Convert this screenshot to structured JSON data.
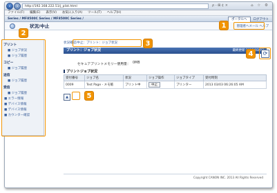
{
  "browser": {
    "url": "http://192.168.222.51/j_plist.html",
    "url_icons": "ρ - ⊠ ¢ ×",
    "win_buttons": "⌂ ☆ ⚙"
  },
  "menu": [
    "ファイル(F)",
    "編集(E)",
    "表示(V)",
    "お気に入り(A)",
    "ツール(T)",
    "ヘルプ(H)"
  ],
  "titlebar": {
    "path": "Series / MF8500C Series / MF8500C Series /",
    "portal_label": "ポータルへ",
    "logout_label": "ログアウト"
  },
  "subheader": {
    "title": "状況/中止",
    "links": "管理者へメール  ヘルプ"
  },
  "sidebar": {
    "sections": [
      {
        "label": "プリント",
        "items": [
          "■ ジョブ状況",
          "■ ジョブ履歴"
        ]
      },
      {
        "label": "コピー",
        "items": [
          "■ ジョブ履歴"
        ]
      },
      {
        "label": "送信",
        "items": [
          "■ ジョブ履歴"
        ]
      },
      {
        "label": "受信",
        "items": [
          "■ ジョブ履歴"
        ]
      }
    ],
    "extra_items": [
      "■ エラー情報",
      "■ デバイス情報",
      "■ デバイス情報",
      "■ カウンター確認"
    ]
  },
  "main": {
    "breadcrumb": "状況確認/中止：プリント：ジョブ状況",
    "box_title": "プリント：ジョブ状況",
    "timestamp": "最終更新 2013/03/03",
    "memory_label": "セキュアプリントメモリー使用量：",
    "memory_value": "0MB",
    "list_title": "プリントジョブ状況",
    "columns": [
      "受付番号",
      "ジョブ名",
      "状況",
      "ジョブ操作",
      "ジョブタイプ",
      "受付時刻"
    ],
    "rows": [
      {
        "id": "0009",
        "name": "Test Page - メモ帳",
        "status": "プリント中",
        "action": "中止",
        "type": "プリンター",
        "time": "2013 03/03 06:26:05 AM"
      }
    ]
  },
  "footer": {
    "copyright": "Copyright CANON INC. 2013 All Rights Reserved"
  },
  "callouts": [
    "1",
    "2",
    "3",
    "4",
    "5"
  ],
  "accent": "#f29400"
}
